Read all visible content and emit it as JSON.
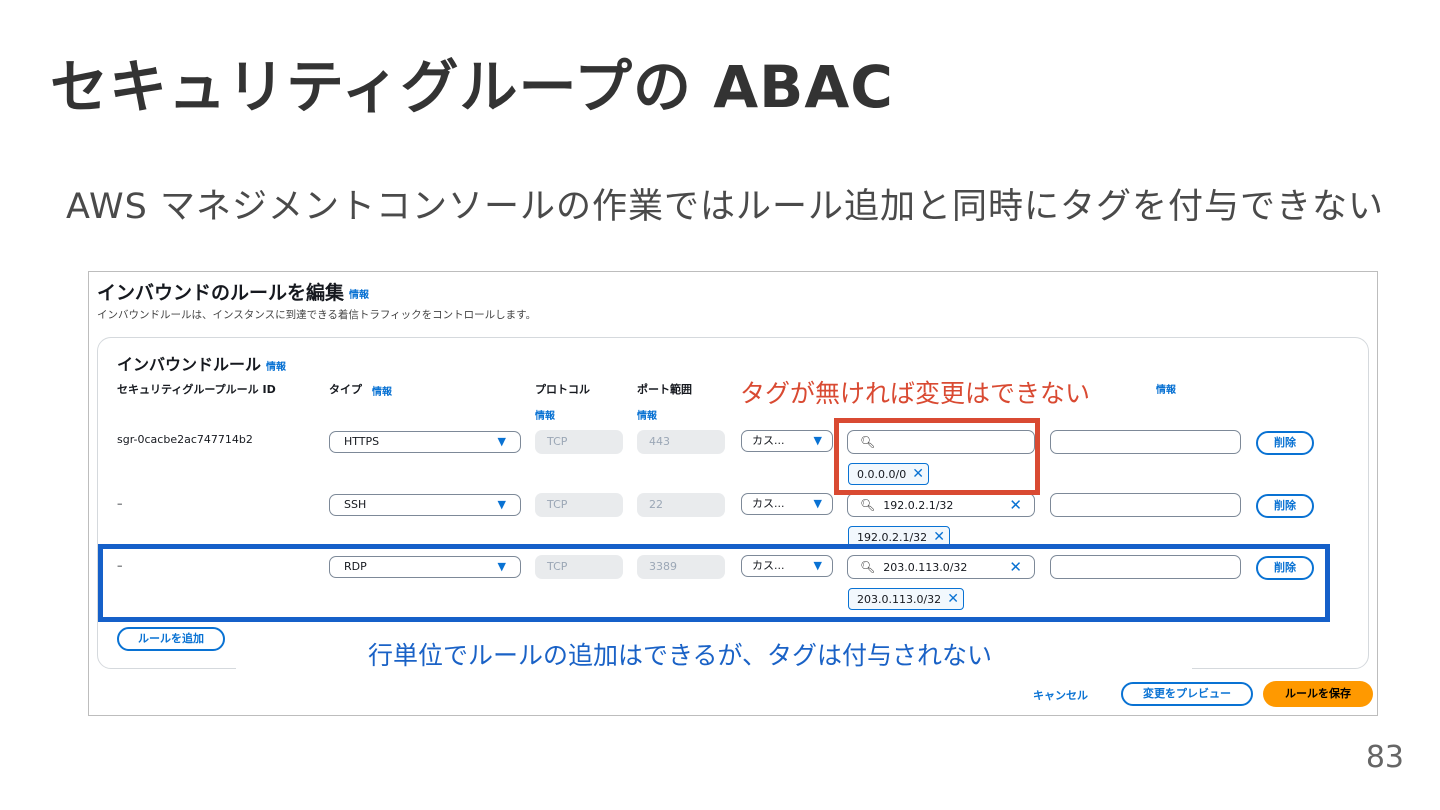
{
  "slide": {
    "title": "セキュリティグループの ABAC",
    "subtitle": "AWS マネジメントコンソールの作業ではルール追加と同時にタグを付与できない",
    "page_number": "83"
  },
  "console": {
    "header": {
      "title": "インバウンドのルールを編集",
      "info": "情報",
      "description": "インバウンドルールは、インスタンスに到達できる着信トラフィックをコントロールします。"
    },
    "panel": {
      "title": "インバウンドルール",
      "info": "情報",
      "columns": {
        "rule_id": "セキュリティグループルール ID",
        "type": "タイプ",
        "type_info": "情報",
        "protocol": "プロトコル",
        "protocol_info": "情報",
        "port_range": "ポート範囲",
        "port_info": "情報",
        "description_info": "情報"
      },
      "rows": [
        {
          "rule_id": "sgr-0cacbe2ac747714b2",
          "type": "HTTPS",
          "protocol": "TCP",
          "port": "443",
          "source_type": "カス...",
          "source_search": "",
          "source_token": "0.0.0.0/0",
          "delete": "削除"
        },
        {
          "rule_id": "–",
          "type": "SSH",
          "protocol": "TCP",
          "port": "22",
          "source_type": "カス...",
          "source_search": "192.0.2.1/32",
          "source_token": "192.0.2.1/32",
          "delete": "削除"
        },
        {
          "rule_id": "–",
          "type": "RDP",
          "protocol": "TCP",
          "port": "3389",
          "source_type": "カス...",
          "source_search": "203.0.113.0/32",
          "source_token": "203.0.113.0/32",
          "delete": "削除"
        }
      ],
      "add_rule": "ルールを追加"
    },
    "footer": {
      "cancel": "キャンセル",
      "preview": "変更をプレビュー",
      "save": "ルールを保存"
    }
  },
  "annotations": {
    "red_note": "タグが無ければ変更はできない",
    "blue_note": "行単位でルールの追加はできるが、タグは付与されない"
  },
  "colors": {
    "accent_blue": "#0972d3",
    "save_orange": "#ff9900",
    "annotation_red": "#d94a32",
    "annotation_blue": "#1560c9"
  }
}
